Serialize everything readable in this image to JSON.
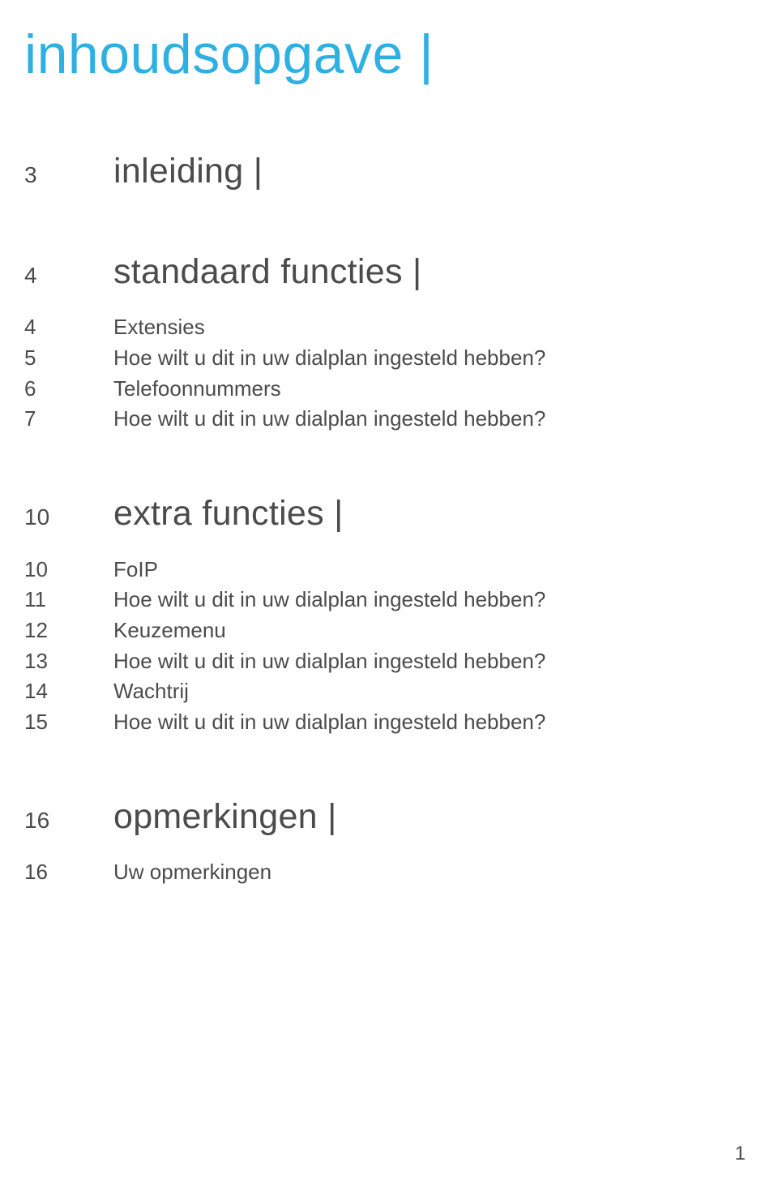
{
  "title": "inhoudsopgave |",
  "footer_page_number": "1",
  "sections": {
    "intro": {
      "page": "3",
      "label": "inleiding |"
    },
    "standard": {
      "page": "4",
      "label": "standaard functies |",
      "items": [
        {
          "page": "4",
          "label": "Extensies"
        },
        {
          "page": "5",
          "label": "Hoe wilt u dit in uw dialplan ingesteld hebben?"
        },
        {
          "page": "6",
          "label": "Telefoonnummers"
        },
        {
          "page": "7",
          "label": "Hoe wilt u dit in uw dialplan ingesteld hebben?"
        }
      ]
    },
    "extra": {
      "page": "10",
      "label": "extra functies |",
      "items": [
        {
          "page": "10",
          "label": "FoIP"
        },
        {
          "page": "11",
          "label": "Hoe wilt u dit in uw dialplan ingesteld hebben?"
        },
        {
          "page": "12",
          "label": "Keuzemenu"
        },
        {
          "page": "13",
          "label": "Hoe wilt u dit in uw dialplan ingesteld hebben?"
        },
        {
          "page": "14",
          "label": "Wachtrij"
        },
        {
          "page": "15",
          "label": "Hoe wilt u dit in uw dialplan ingesteld hebben?"
        }
      ]
    },
    "notes": {
      "page": "16",
      "label": "opmerkingen |",
      "items": [
        {
          "page": "16",
          "label": "Uw opmerkingen"
        }
      ]
    }
  }
}
